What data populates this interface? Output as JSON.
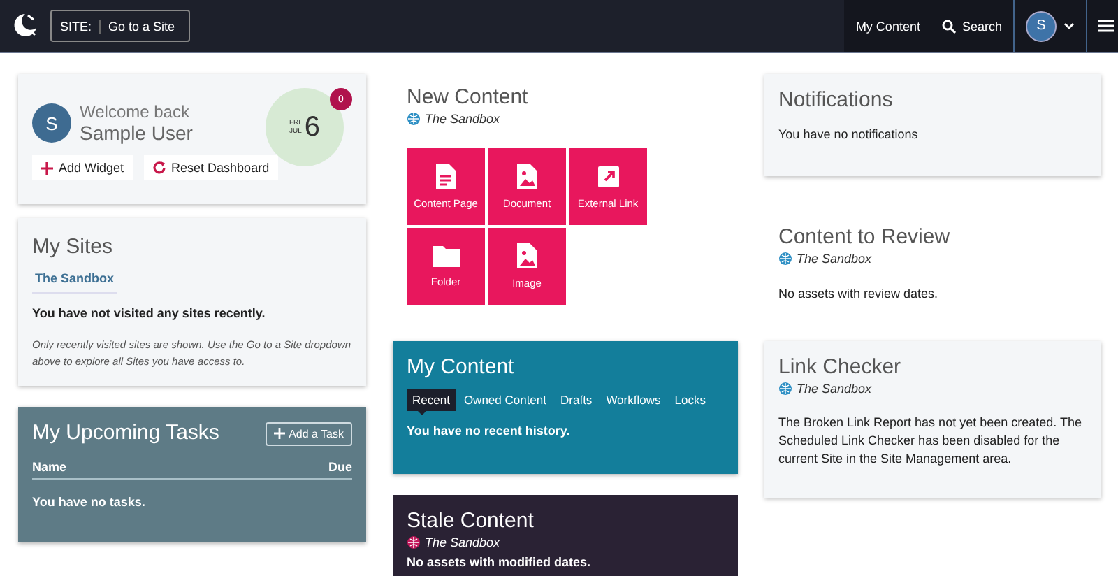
{
  "header": {
    "site_label": "SITE:",
    "site_placeholder": "Go to a Site",
    "nav": [
      "My Content",
      "Search"
    ],
    "avatar": "S"
  },
  "columns": [
    [
      {
        "kind": "welcome",
        "avatar": "S",
        "greeting": "Welcome back",
        "name": "Sample User",
        "weekday": "FRI",
        "month": "JUL",
        "day": "6",
        "badge": "0",
        "buttons": [
          {
            "kind": "add",
            "label": "Add Widget"
          },
          {
            "kind": "reset",
            "label": "Reset Dashboard"
          }
        ]
      },
      {
        "kind": "sites",
        "title": "My Sites",
        "sites": [
          "The Sandbox"
        ],
        "message": "You have not visited any sites recently.",
        "note": "Only recently visited sites are shown. Use the Go to a Site dropdown above to explore all Sites you have access to."
      },
      {
        "kind": "tasks",
        "title": "My Upcoming Tasks",
        "button": "Add a Task",
        "table_columns": [
          "Name",
          "Due"
        ],
        "message": "You have no tasks."
      }
    ],
    [
      {
        "kind": "new_content",
        "title": "New Content",
        "site": "The Sandbox",
        "tiles": [
          {
            "kind": "page",
            "label": "Content Page"
          },
          {
            "kind": "document",
            "label": "Document"
          },
          {
            "kind": "link",
            "label": "External Link"
          },
          {
            "kind": "folder",
            "label": "Folder"
          },
          {
            "kind": "image",
            "label": "Image"
          }
        ]
      },
      {
        "kind": "my_content",
        "title": "My Content",
        "tabs": [
          {
            "label": "Recent",
            "selected": true
          },
          {
            "label": "Owned Content",
            "selected": false
          },
          {
            "label": "Drafts",
            "selected": false
          },
          {
            "label": "Workflows",
            "selected": false
          },
          {
            "label": "Locks",
            "selected": false
          }
        ],
        "message": "You have no recent history."
      },
      {
        "kind": "stale",
        "title": "Stale Content",
        "site": "The Sandbox",
        "message": "No assets with modified dates."
      }
    ],
    [
      {
        "kind": "notifications",
        "title": "Notifications",
        "message": "You have no notifications"
      },
      {
        "kind": "review",
        "title": "Content to Review",
        "site": "The Sandbox",
        "message": "No assets with review dates."
      },
      {
        "kind": "link_checker",
        "title": "Link Checker",
        "site": "The Sandbox",
        "message": "The Broken Link Report has not yet been created. The Scheduled Link Checker has been disabled for the current Site in the Site Management area."
      }
    ]
  ]
}
